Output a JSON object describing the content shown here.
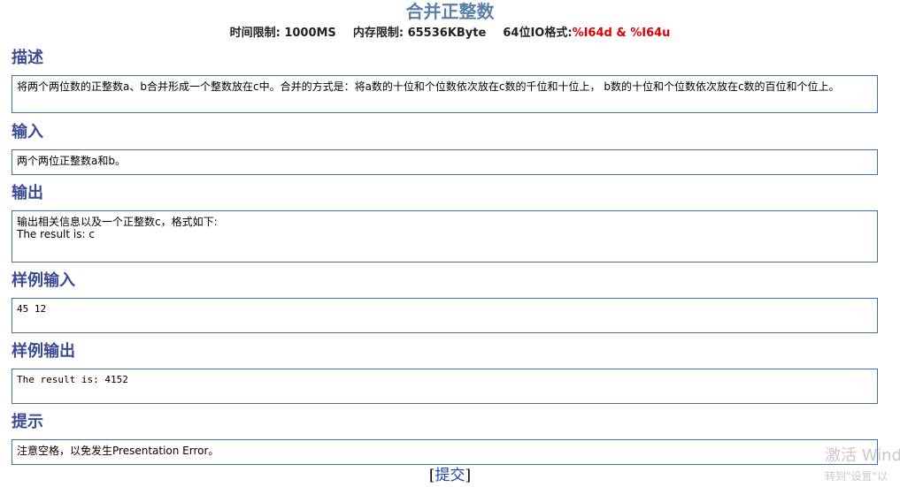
{
  "problem": {
    "title": "合并正整数",
    "time_limit_label": "时间限制:",
    "time_limit_value": "1000MS",
    "memory_limit_label": "内存限制:",
    "memory_limit_value": "65536KByte",
    "io_format_label": "64位IO格式:",
    "io_format_value": "%I64d & %I64u"
  },
  "sections": {
    "description": {
      "heading": "描述",
      "text": "将两个两位数的正整数a、b合并形成一个整数放在c中。合并的方式是：将a数的十位和个位数依次放在c数的千位和十位上， b数的十位和个位数依次放在c数的百位和个位上。"
    },
    "input": {
      "heading": "输入",
      "text": "两个两位正整数a和b。"
    },
    "output": {
      "heading": "输出",
      "line1": "输出相关信息以及一个正整数c，格式如下:",
      "line2": "The result is: c"
    },
    "sample_input": {
      "heading": "样例输入",
      "text": "45 12"
    },
    "sample_output": {
      "heading": "样例输出",
      "text": "The result is: 4152"
    },
    "hint": {
      "heading": "提示",
      "text": "注意空格，以免发生Presentation Error。"
    }
  },
  "actions": {
    "open_bracket": "[",
    "submit_label": "提交",
    "close_bracket": "]"
  },
  "watermark": {
    "line1": "激活 Wind",
    "line2": "转到\"设置\"以"
  }
}
